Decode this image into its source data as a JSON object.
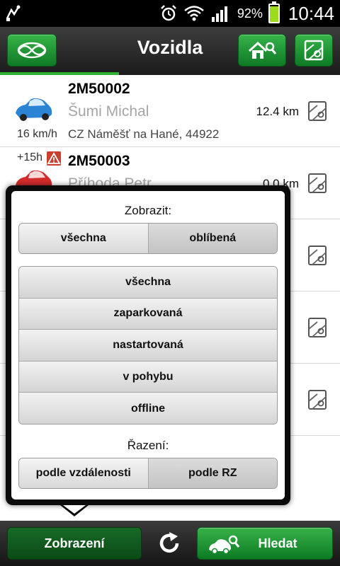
{
  "status_bar": {
    "battery": "92%",
    "time": "10:44",
    "battery_level": 0.92
  },
  "title_bar": {
    "title": "Vozidla"
  },
  "vehicles": [
    {
      "plate": "2M50002",
      "driver": "Šumi Michal",
      "distance": "12.4 km",
      "address": "CZ Náměšť na Hané, 44922",
      "speed": "16 km/h",
      "car_color": "#2c84d4"
    },
    {
      "plate": "2M50003",
      "driver": "Příhoda Petr",
      "distance": "0.0 km",
      "age": "+15h",
      "car_color": "#d42c2c"
    }
  ],
  "popup": {
    "show_label": "Zobrazit:",
    "show_options": [
      "všechna",
      "oblíbená"
    ],
    "show_selected": "oblíbená",
    "state_options": [
      "všechna",
      "zaparkovaná",
      "nastartovaná",
      "v pohybu",
      "offline"
    ],
    "state_selected": "všechna",
    "sort_label": "Řazení:",
    "sort_options": [
      "podle vzdálenosti",
      "podle RZ"
    ],
    "sort_selected": "podle RZ"
  },
  "bottom_bar": {
    "display_label": "Zobrazení",
    "search_label": "Hledat"
  },
  "colors": {
    "accent_green": "#1f9a35",
    "warning_red": "#c9402f"
  }
}
